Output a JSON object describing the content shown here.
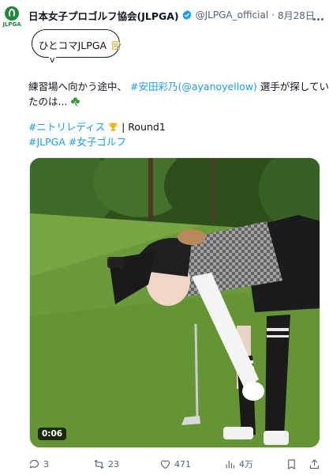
{
  "tweet": {
    "avatar_logo_text": "JLPGA",
    "display_name": "日本女子プロゴルフ協会(JLPGA)",
    "handle": "@JLPGA_official",
    "separator": "·",
    "date": "8月28日",
    "bubble_text": "ひとコマJLPGA",
    "bubble_tail": "v",
    "text_line1_a": "練習場へ向かう途中、",
    "text_line1_link": "#安田彩乃(@ayanoyellow)",
    "text_line1_b": "選手が探してい",
    "text_line2": "たのは...",
    "hashtag_nitori": "#ニトリレディス",
    "round_text": "| Round1",
    "hashtag_jlpga": "#JLPGA",
    "hashtag_joshi": "#女子ゴルフ",
    "video_duration": "0:06",
    "stats": {
      "replies": "3",
      "reposts": "23",
      "likes": "471",
      "views": "4万"
    }
  },
  "icons": [
    "verified-badge-icon",
    "more-icon",
    "memo-icon",
    "clover-icon",
    "trophy-icon",
    "reply-icon",
    "repost-icon",
    "like-icon",
    "views-icon",
    "bookmark-icon",
    "share-icon"
  ],
  "colors": {
    "link": "#1d9bf0",
    "secondary_text": "#536471",
    "brand_green": "#1f8a3b"
  }
}
